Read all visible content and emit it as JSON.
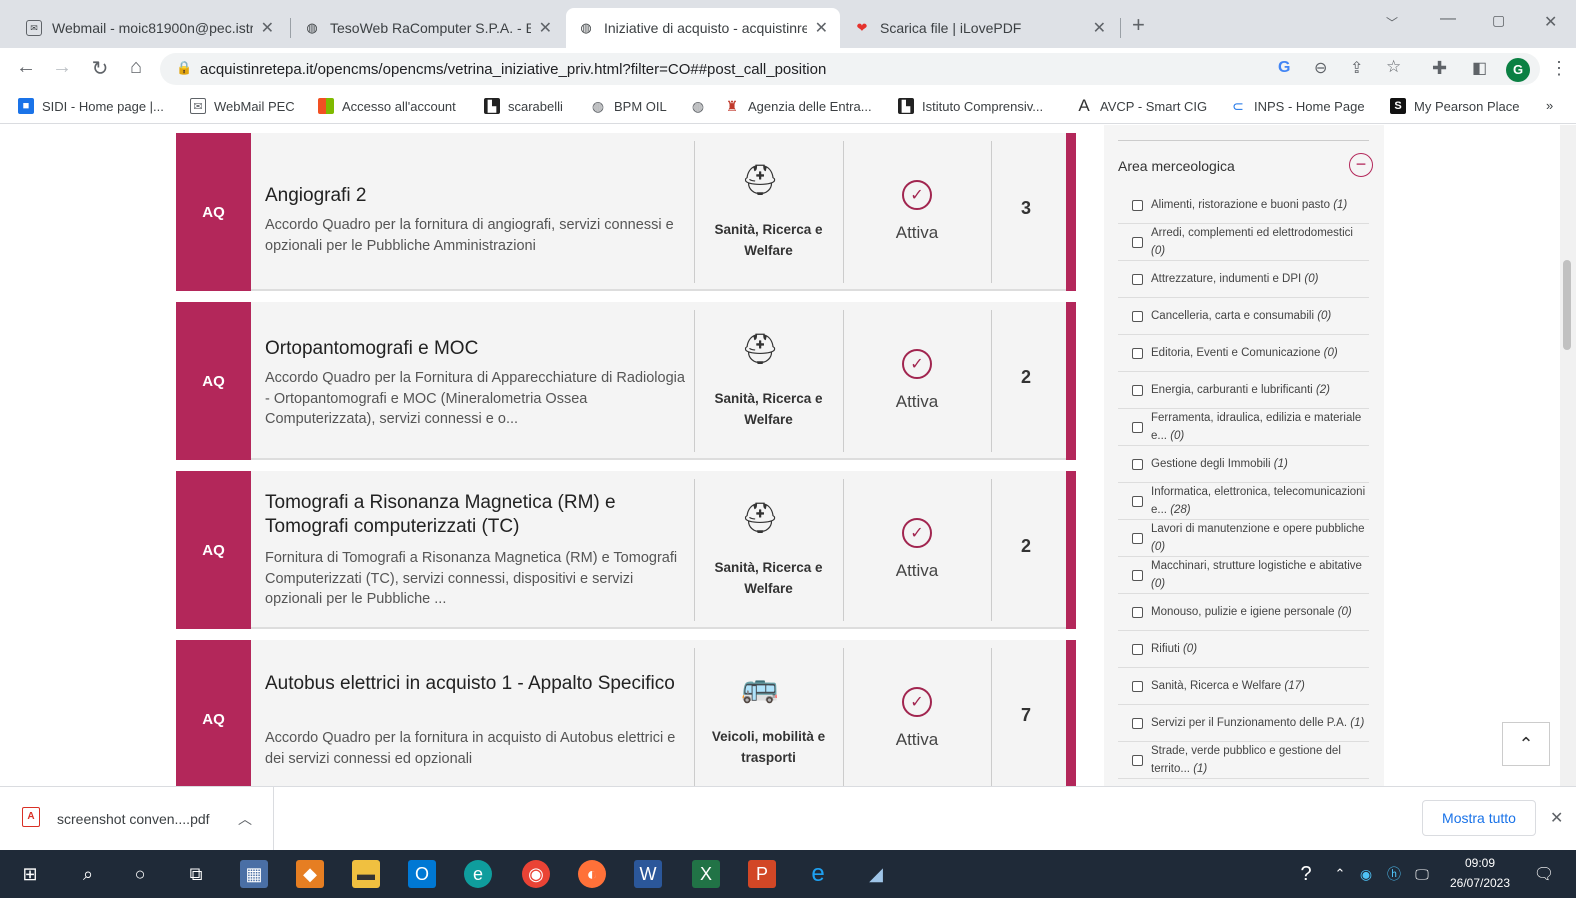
{
  "tabs": [
    {
      "title": "Webmail - moic81900n@pec.istr",
      "icon": "webmail-icon"
    },
    {
      "title": "TesoWeb RaComputer S.P.A. - Bi",
      "icon": "globe-icon"
    },
    {
      "title": "Iniziative di acquisto - acquistinre",
      "icon": "globe-icon"
    },
    {
      "title": "Scarica file | iLovePDF",
      "icon": "heart-icon"
    }
  ],
  "new_tab": "+",
  "address": {
    "url": "acquistinretepa.it/opencms/opencms/vetrina_iniziative_priv.html?filter=CO##post_call_position"
  },
  "profile_initial": "G",
  "bookmarks": [
    "SIDI - Home page |...",
    "WebMail PEC",
    "Accesso all'account",
    "scarabelli",
    "BPM OIL",
    "",
    "Agenzia delle Entra...",
    "Istituto Comprensiv...",
    "AVCP - Smart CIG",
    "INPS - Home Page",
    "My Pearson Place"
  ],
  "bookmarks_more": "»",
  "cards": [
    {
      "badge": "AQ",
      "title": "Angiografi 2",
      "description": "Accordo Quadro per la fornitura di angiografi, servizi connessi e opzionali per le Pubbliche Amministrazioni",
      "category": "Sanità, Ricerca e Welfare",
      "status": "Attiva",
      "count": "3"
    },
    {
      "badge": "AQ",
      "title": "Ortopantomografi e MOC",
      "description": "Accordo Quadro per la Fornitura di Apparecchiature di Radiologia -  Ortopantomografi e MOC (Mineralometria Ossea Computerizzata), servizi connessi e o...",
      "category": "Sanità, Ricerca e Welfare",
      "status": "Attiva",
      "count": "2"
    },
    {
      "badge": "AQ",
      "title": "Tomografi a Risonanza Magnetica (RM) e Tomografi computerizzati (TC)",
      "description": "Fornitura di Tomografi a Risonanza Magnetica (RM) e Tomografi Computerizzati (TC), servizi connessi, dispositivi e servizi opzionali per le Pubbliche ...",
      "category": "Sanità, Ricerca e Welfare",
      "status": "Attiva",
      "count": "2"
    },
    {
      "badge": "AQ",
      "title": "Autobus elettrici in acquisto 1 - Appalto Specifico",
      "description": "Accordo Quadro per la fornitura in acquisto di Autobus elettrici e dei servizi connessi ed opzionali",
      "category": "Veicoli, mobilità e trasporti",
      "status": "Attiva",
      "count": "7"
    }
  ],
  "filter": {
    "heading": "Area merceologica",
    "collapse_symbol": "−",
    "items": [
      {
        "label": "Alimenti, ristorazione e buoni pasto",
        "count": "(1)"
      },
      {
        "label": "Arredi, complementi ed elettrodomestici",
        "count": "(0)"
      },
      {
        "label": "Attrezzature, indumenti e DPI",
        "count": "(0)"
      },
      {
        "label": "Cancelleria, carta e consumabili",
        "count": "(0)"
      },
      {
        "label": "Editoria, Eventi e Comunicazione",
        "count": "(0)"
      },
      {
        "label": "Energia, carburanti e lubrificanti",
        "count": "(2)"
      },
      {
        "label": "Ferramenta, idraulica, edilizia e materiale e...",
        "count": "(0)"
      },
      {
        "label": "Gestione degli Immobili",
        "count": "(1)"
      },
      {
        "label": "Informatica, elettronica, telecomunicazioni e...",
        "count": "(28)"
      },
      {
        "label": "Lavori di manutenzione e opere pubbliche",
        "count": "(0)"
      },
      {
        "label": "Macchinari, strutture logistiche e abitative",
        "count": "(0)"
      },
      {
        "label": "Monouso, pulizie e igiene personale",
        "count": "(0)"
      },
      {
        "label": "Rifiuti",
        "count": "(0)"
      },
      {
        "label": "Sanità, Ricerca e Welfare",
        "count": "(17)"
      },
      {
        "label": "Servizi per il Funzionamento delle P.A.",
        "count": "(1)"
      },
      {
        "label": "Strade, verde pubblico e gestione del territo...",
        "count": "(1)"
      }
    ]
  },
  "back_to_top": "⌃",
  "download": {
    "file": "screenshot conven....pdf",
    "show_all": "Mostra tutto",
    "close": "✕"
  },
  "clock": {
    "time": "09:09",
    "date": "26/07/2023"
  },
  "colors": {
    "accent": "#b3275a",
    "taskbar": "#1f2a38"
  }
}
